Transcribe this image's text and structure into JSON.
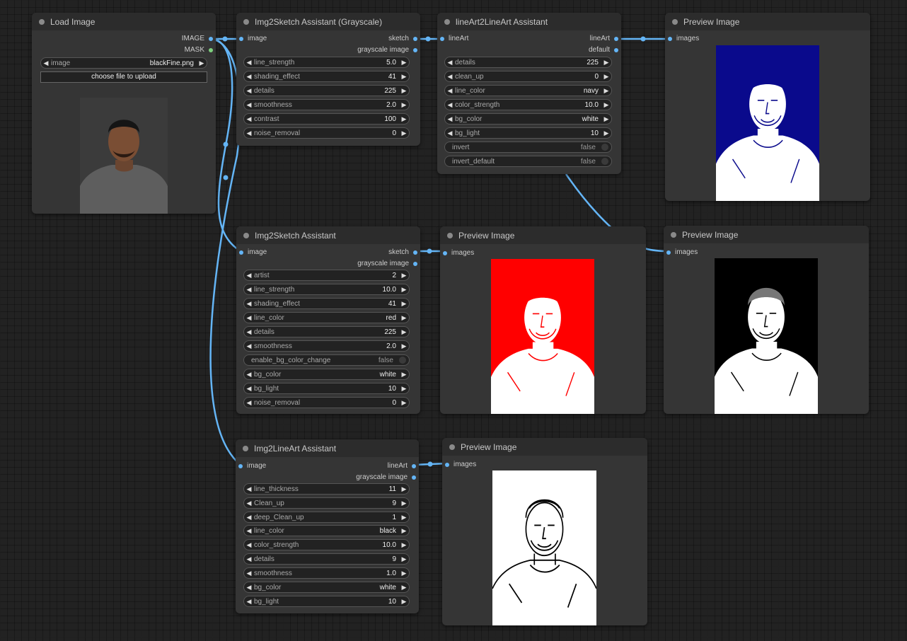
{
  "nodes": {
    "load_image": {
      "title": "Load Image",
      "outputs": [
        "IMAGE",
        "MASK"
      ],
      "image_label": "image",
      "image_value": "blackFine.png",
      "upload_label": "choose file to upload"
    },
    "img2sketch_gray": {
      "title": "Img2Sketch Assistant (Grayscale)",
      "input": "image",
      "outputs": [
        "sketch",
        "grayscale image"
      ],
      "widgets": [
        {
          "label": "line_strength",
          "value": "5.0"
        },
        {
          "label": "shading_effect",
          "value": "41"
        },
        {
          "label": "details",
          "value": "225"
        },
        {
          "label": "smoothness",
          "value": "2.0"
        },
        {
          "label": "contrast",
          "value": "100"
        },
        {
          "label": "noise_removal",
          "value": "0"
        }
      ]
    },
    "lineart2lineart": {
      "title": "lineArt2LineArt Assistant",
      "input": "lineArt",
      "outputs": [
        "lineArt",
        "default"
      ],
      "widgets": [
        {
          "label": "details",
          "value": "225"
        },
        {
          "label": "clean_up",
          "value": "0"
        },
        {
          "label": "line_color",
          "value": "navy"
        },
        {
          "label": "color_strength",
          "value": "10.0"
        },
        {
          "label": "bg_color",
          "value": "white"
        },
        {
          "label": "bg_light",
          "value": "10"
        }
      ],
      "toggles": [
        {
          "label": "invert",
          "value": "false"
        },
        {
          "label": "invert_default",
          "value": "false"
        }
      ]
    },
    "preview1": {
      "title": "Preview Image",
      "input": "images"
    },
    "img2sketch": {
      "title": "Img2Sketch Assistant",
      "input": "image",
      "outputs": [
        "sketch",
        "grayscale image"
      ],
      "widgets": [
        {
          "label": "artist",
          "value": "2"
        },
        {
          "label": "line_strength",
          "value": "10.0"
        },
        {
          "label": "shading_effect",
          "value": "41"
        },
        {
          "label": "line_color",
          "value": "red"
        },
        {
          "label": "details",
          "value": "225"
        },
        {
          "label": "smoothness",
          "value": "2.0"
        }
      ],
      "toggle": {
        "label": "enable_bg_color_change",
        "value": "false"
      },
      "widgets2": [
        {
          "label": "bg_color",
          "value": "white"
        },
        {
          "label": "bg_light",
          "value": "10"
        },
        {
          "label": "noise_removal",
          "value": "0"
        }
      ]
    },
    "preview2": {
      "title": "Preview Image",
      "input": "images"
    },
    "preview3": {
      "title": "Preview Image",
      "input": "images"
    },
    "img2lineart": {
      "title": "Img2LineArt Assistant",
      "input": "image",
      "outputs": [
        "lineArt",
        "grayscale image"
      ],
      "widgets": [
        {
          "label": "line_thickness",
          "value": "11"
        },
        {
          "label": "Clean_up",
          "value": "9"
        },
        {
          "label": "deep_Clean_up",
          "value": "1"
        },
        {
          "label": "line_color",
          "value": "black"
        },
        {
          "label": "color_strength",
          "value": "10.0"
        },
        {
          "label": "details",
          "value": "9"
        },
        {
          "label": "smoothness",
          "value": "1.0"
        },
        {
          "label": "bg_color",
          "value": "white"
        },
        {
          "label": "bg_light",
          "value": "10"
        }
      ]
    },
    "preview4": {
      "title": "Preview Image",
      "input": "images"
    }
  },
  "colors": {
    "link": "#64b5f6",
    "preview1_bg": "#0a0a8c",
    "preview1_line": "#ffffff",
    "preview2_bg": "#ff0000",
    "preview2_line": "#ffffff",
    "preview3_bg": "#000000",
    "preview3_line": "#ffffff",
    "preview4_bg": "#ffffff",
    "preview4_line": "#000000"
  }
}
